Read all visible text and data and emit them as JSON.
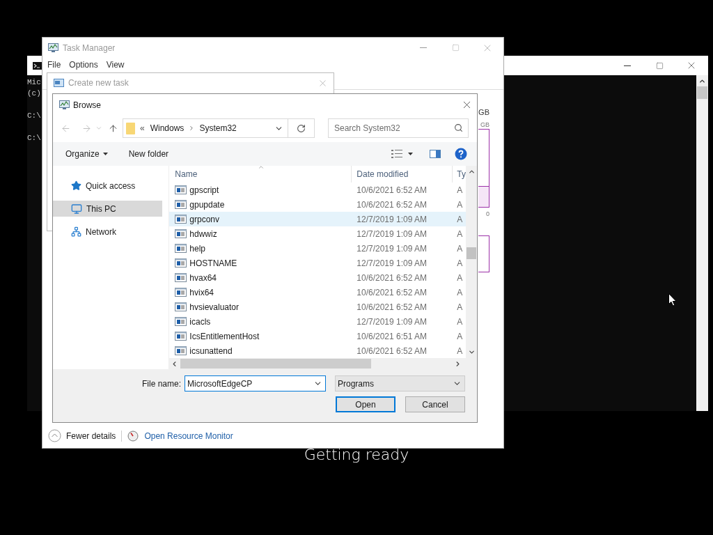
{
  "console": {
    "text_blocks": [
      [
        "Mic",
        "(c)"
      ],
      [
        "C:\\"
      ],
      [
        "C:\\"
      ]
    ]
  },
  "task_manager": {
    "title": "Task Manager",
    "menu": [
      "File",
      "Options",
      "View"
    ],
    "memory_labels": {
      "total": "GB",
      "scale": "GB",
      "axis_min": "0"
    },
    "footer": {
      "details_toggle": "Fewer details",
      "resource_monitor_link": "Open Resource Monitor"
    }
  },
  "create_task": {
    "title": "Create new task"
  },
  "browse": {
    "title": "Browse",
    "breadcrumb": {
      "overflow": "«",
      "items": [
        "Windows",
        "System32"
      ]
    },
    "search": {
      "placeholder": "Search System32"
    },
    "toolbar": {
      "organize": "Organize",
      "new_folder": "New folder"
    },
    "nav_pane": [
      {
        "label": "Quick access",
        "kind": "quick-access",
        "selected": false
      },
      {
        "label": "This PC",
        "kind": "pc",
        "selected": true
      },
      {
        "label": "Network",
        "kind": "network",
        "selected": false
      }
    ],
    "columns": [
      "Name",
      "Date modified",
      "Ty"
    ],
    "files": [
      {
        "name": "gpscript",
        "date": "10/6/2021 6:52 AM",
        "type": "A",
        "highlighted": false
      },
      {
        "name": "gpupdate",
        "date": "10/6/2021 6:52 AM",
        "type": "A",
        "highlighted": false
      },
      {
        "name": "grpconv",
        "date": "12/7/2019 1:09 AM",
        "type": "A",
        "highlighted": true
      },
      {
        "name": "hdwwiz",
        "date": "12/7/2019 1:09 AM",
        "type": "A",
        "highlighted": false
      },
      {
        "name": "help",
        "date": "12/7/2019 1:09 AM",
        "type": "A",
        "highlighted": false
      },
      {
        "name": "HOSTNAME",
        "date": "12/7/2019 1:09 AM",
        "type": "A",
        "highlighted": false
      },
      {
        "name": "hvax64",
        "date": "10/6/2021 6:52 AM",
        "type": "A",
        "highlighted": false
      },
      {
        "name": "hvix64",
        "date": "10/6/2021 6:52 AM",
        "type": "A",
        "highlighted": false
      },
      {
        "name": "hvsievaluator",
        "date": "10/6/2021 6:52 AM",
        "type": "A",
        "highlighted": false
      },
      {
        "name": "icacls",
        "date": "12/7/2019 1:09 AM",
        "type": "A",
        "highlighted": false
      },
      {
        "name": "IcsEntitlementHost",
        "date": "10/6/2021 6:51 AM",
        "type": "A",
        "highlighted": false
      },
      {
        "name": "icsunattend",
        "date": "10/6/2021 6:52 AM",
        "type": "A",
        "highlighted": false
      }
    ],
    "file_name": {
      "label": "File name:",
      "value": "MicrosoftEdgeCP"
    },
    "file_type": "Programs",
    "buttons": [
      {
        "label": "Open",
        "default": true
      },
      {
        "label": "Cancel",
        "default": false
      }
    ]
  },
  "overlay_text": "Getting ready"
}
